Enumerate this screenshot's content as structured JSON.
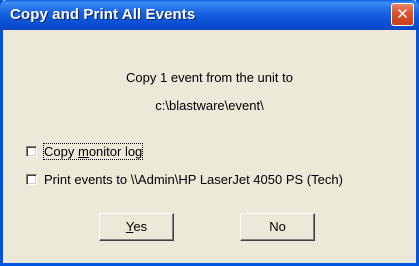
{
  "window": {
    "title": "Copy and Print All Events",
    "close_symbol": "✕"
  },
  "message": {
    "line1": "Copy 1 event from the unit to",
    "line2": "c:\\blastware\\event\\"
  },
  "options": [
    {
      "label_prefix": "Copy ",
      "label_accel": "m",
      "label_rest": "onitor log",
      "checked": false
    },
    {
      "label": "Print events to \\\\Admin\\HP LaserJet 4050 PS (Tech)",
      "checked": false
    }
  ],
  "buttons": {
    "yes_accel": "Y",
    "yes_rest": "es",
    "no": "No"
  }
}
